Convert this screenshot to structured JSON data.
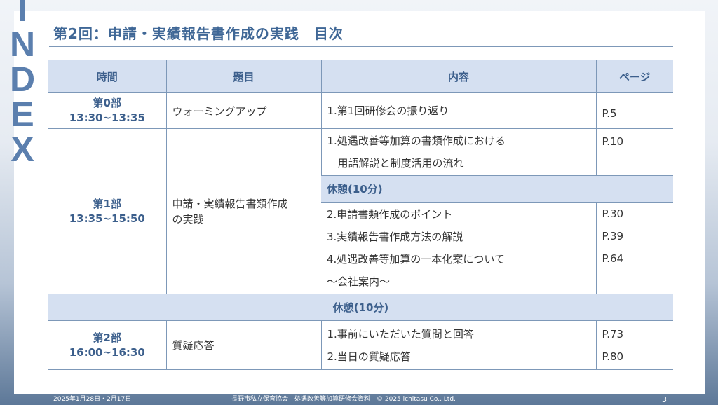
{
  "sidebar_word": [
    "I",
    "N",
    "D",
    "E",
    "X"
  ],
  "title": "第2回：申請・実績報告書作成の実践　目次",
  "table": {
    "headers": [
      "時間",
      "題目",
      "内容",
      "ページ"
    ],
    "part0": {
      "time_label": "第0部",
      "time_range": "13:30~13:35",
      "topic": "ウォーミングアップ",
      "content": [
        "1.第1回研修会の振り返り"
      ],
      "pages": [
        "P.5"
      ]
    },
    "part1": {
      "time_label": "第1部",
      "time_range": "13:35~15:50",
      "topic_lines": [
        "申請・実績報告書類作成",
        "の実践"
      ],
      "section_a": {
        "content": [
          "1.処遇改善等加算の書類作成における",
          "　用語解説と制度活用の流れ"
        ],
        "pages": [
          "P.10"
        ]
      },
      "break": "休憩(10分)",
      "section_b": {
        "content": [
          "2.申請書類作成のポイント",
          "3.実績報告書作成方法の解説",
          "4.処遇改善等加算の一本化案について",
          "～会社案内～"
        ],
        "pages": [
          "P.30",
          "P.39",
          "P.64"
        ]
      }
    },
    "break_full": "休憩(10分)",
    "part2": {
      "time_label": "第2部",
      "time_range": "16:00~16:30",
      "topic": "質疑応答",
      "content": [
        "1.事前にいただいた質問と回答",
        "2.当日の質疑応答"
      ],
      "pages": [
        "P.73",
        "P.80"
      ]
    }
  },
  "footer": {
    "date": "2025年1月28日・2月17日",
    "center": "長野市私立保育協会　処遇改善等加算研修会資料　© 2025 ichitasu Co., Ltd.",
    "page_number": "3"
  }
}
